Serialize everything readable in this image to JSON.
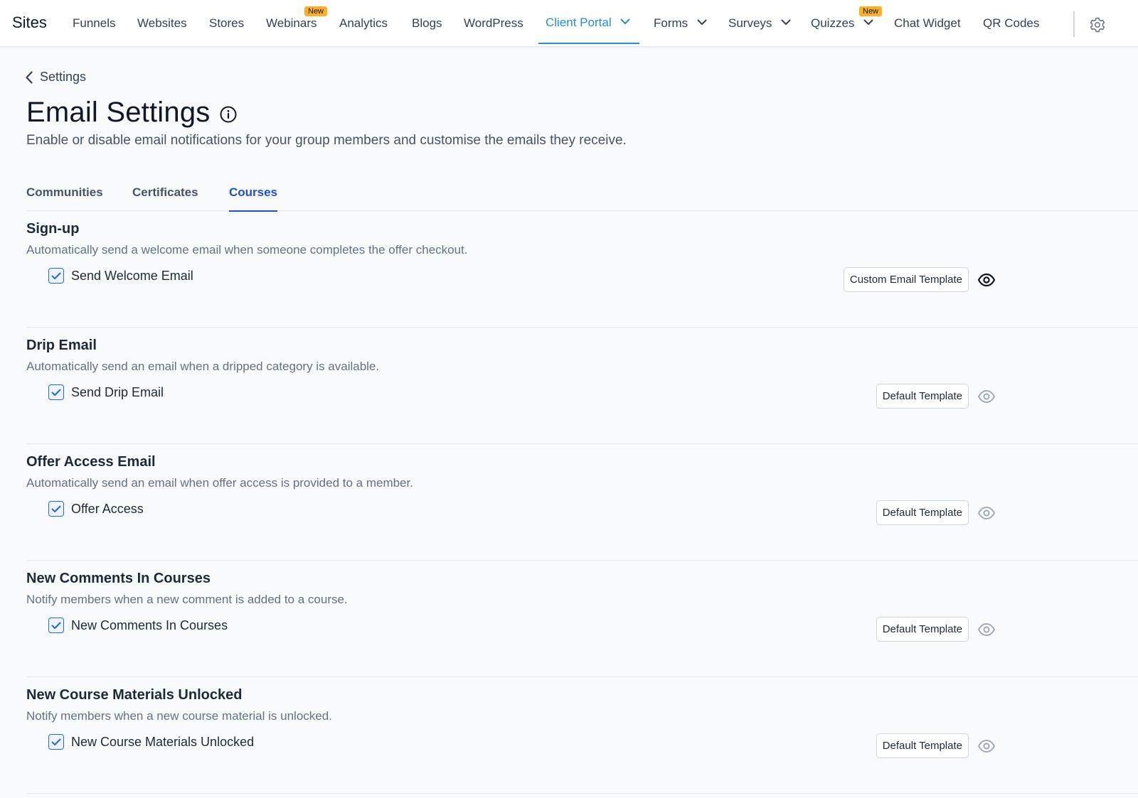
{
  "nav": {
    "brand": "Sites",
    "items": [
      {
        "label": "Funnels"
      },
      {
        "label": "Websites"
      },
      {
        "label": "Stores"
      },
      {
        "label": "Webinars",
        "badge": "New"
      },
      {
        "label": "Analytics"
      },
      {
        "label": "Blogs"
      },
      {
        "label": "WordPress"
      },
      {
        "label": "Client Portal",
        "active": true,
        "dropdown": true
      },
      {
        "label": "Forms",
        "dropdown": true
      },
      {
        "label": "Surveys",
        "dropdown": true
      },
      {
        "label": "Quizzes",
        "badge": "New",
        "dropdown": true
      },
      {
        "label": "Chat Widget"
      },
      {
        "label": "QR Codes"
      }
    ],
    "settings_icon": "gear-icon"
  },
  "header": {
    "back_label": "Settings",
    "title": "Email Settings",
    "subtitle": "Enable or disable email notifications for your group members and customise the emails they receive."
  },
  "tabs": [
    {
      "label": "Communities"
    },
    {
      "label": "Certificates"
    },
    {
      "label": "Courses",
      "active": true
    }
  ],
  "sections": [
    {
      "title": "Sign-up",
      "description": "Automatically send a welcome email when someone completes the offer checkout.",
      "checkbox_label": "Send Welcome Email",
      "checked": true,
      "template_label": "Custom Email Template"
    },
    {
      "title": "Drip Email",
      "description": "Automatically send an email when a dripped category is available.",
      "checkbox_label": "Send Drip Email",
      "checked": true,
      "template_label": "Default Template"
    },
    {
      "title": "Offer Access Email",
      "description": "Automatically send an email when offer access is provided to a member.",
      "checkbox_label": "Offer Access",
      "checked": true,
      "template_label": "Default Template"
    },
    {
      "title": "New Comments In Courses",
      "description": "Notify members when a new comment is added to a course.",
      "checkbox_label": "New Comments In Courses",
      "checked": true,
      "template_label": "Default Template"
    },
    {
      "title": "New Course Materials Unlocked",
      "description": "Notify members when a new course material is unlocked.",
      "checkbox_label": "New Course Materials Unlocked",
      "checked": true,
      "template_label": "Default Template"
    }
  ],
  "colors": {
    "accent_nav": "#1f8fd8",
    "accent_tab": "#1d4ed8",
    "badge": "#fdb022",
    "checkbox": "#2563eb"
  }
}
